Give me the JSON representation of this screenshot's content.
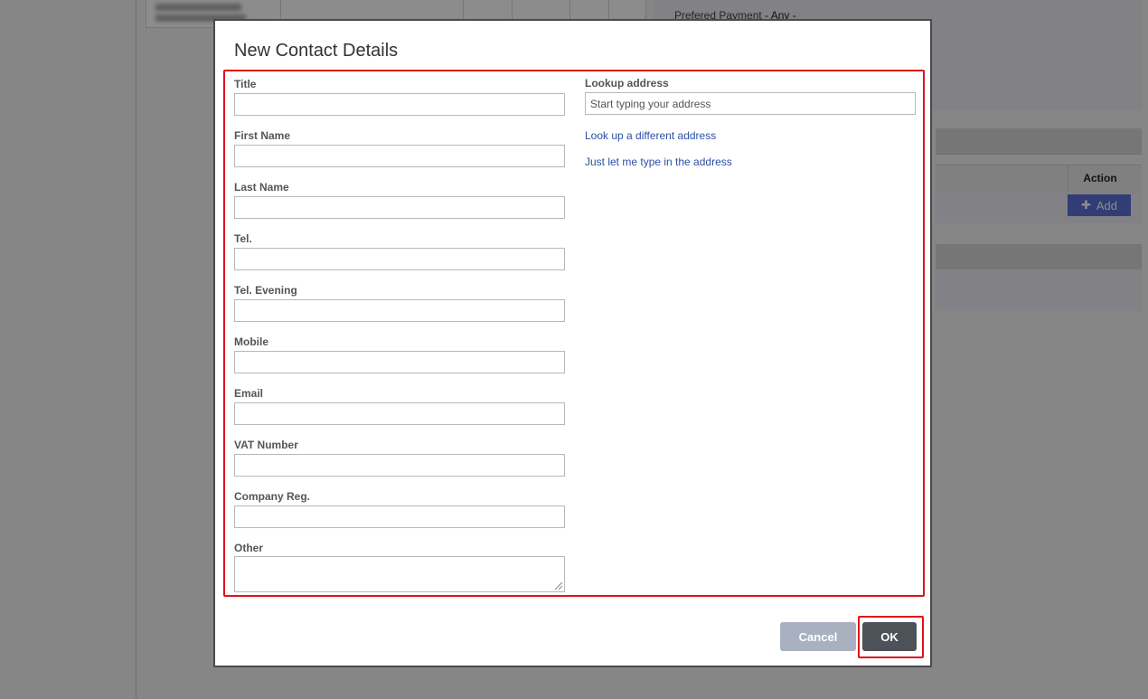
{
  "background": {
    "preferred_payment_label": "Prefered Payment",
    "preferred_payment_value": "- Any -",
    "action_header": "Action",
    "add_button_label": "Add"
  },
  "dialog": {
    "title": "New Contact Details",
    "fields": [
      {
        "label": "Title",
        "value": ""
      },
      {
        "label": "First Name",
        "value": ""
      },
      {
        "label": "Last Name",
        "value": ""
      },
      {
        "label": "Tel.",
        "value": ""
      },
      {
        "label": "Tel. Evening",
        "value": ""
      },
      {
        "label": "Mobile",
        "value": ""
      },
      {
        "label": "Email",
        "value": ""
      },
      {
        "label": "VAT Number",
        "value": ""
      },
      {
        "label": "Company Reg.",
        "value": ""
      }
    ],
    "other": {
      "label": "Other",
      "value": ""
    },
    "lookup": {
      "label": "Lookup address",
      "placeholder": "Start typing your address",
      "value": ""
    },
    "links": {
      "different_address": "Look up a different address",
      "manual_address": "Just let me type in the address"
    },
    "buttons": {
      "cancel": "Cancel",
      "ok": "OK"
    }
  },
  "colors": {
    "highlight": "#e0121b",
    "link": "#2b4fa3",
    "ok_button": "#4d5258",
    "cancel_button": "#a9b1c1",
    "add_button": "#5b6ed6"
  }
}
